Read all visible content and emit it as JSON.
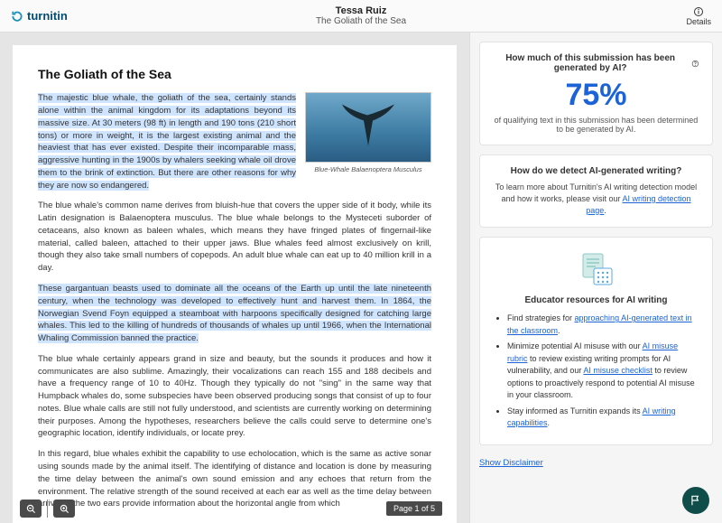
{
  "header": {
    "brand": "turnitin",
    "student_name": "Tessa Ruiz",
    "doc_title": "The Goliath of the Sea",
    "details_label": "Details"
  },
  "document": {
    "title": "The Goliath of the Sea",
    "image_caption": "Blue-Whale Balaenoptera Musculus",
    "p1a": "The majestic blue whale, the goliath of the sea, certainly stands alone within the animal kingdom for its adaptations beyond its massive size. At 30 meters (98 ft) in length and 190 tons (210 short tons) or more in weight, it is the largest existing animal and the heaviest that has ever existed. Despite their incomparable mass, aggressive hunting in the 1900s by whalers seeking whale oil drove them to the brink of extinction. But there are other reasons for why they are now so endangered.",
    "p2": "The blue whale's common name derives from bluish-hue that covers the upper side of it body, while its Latin designation is Balaenoptera musculus. The blue whale belongs to the Mysteceti suborder of cetaceans, also known as baleen whales, which means they have fringed plates of fingernail-like material, called baleen, attached to their upper jaws. Blue whales feed almost exclusively on krill, though they also take small numbers of copepods. An adult blue whale can eat up to 40 million krill in a day.",
    "p3": "These gargantuan beasts used to dominate all the oceans of the Earth up until the late nineteenth century, when the technology was developed to effectively hunt and harvest them. In 1864, the Norwegian Svend Foyn equipped a steamboat with harpoons specifically designed for catching large whales. This led to the killing of hundreds of thousands of whales up until 1966, when the International Whaling Commission banned the practice.",
    "p4": "The blue whale certainly appears grand in size and beauty, but the sounds it produces and how it communicates are also sublime. Amazingly, their vocalizations can reach 155 and 188 decibels and have a frequency range of 10 to 40Hz. Though they typically do not \"sing\" in the same way that Humpback whales do, some subspecies have been observed producing songs that consist of up to four notes. Blue whale calls are still not fully understood, and scientists are currently working on determining their purposes. Among the hypotheses, researchers believe the calls could serve to determine one's geographic location, identify individuals, or locate prey.",
    "p5": "In this regard, blue whales exhibit the capability to use echolocation, which is the same as active sonar using sounds made by the animal itself. The identifying of distance and location is done by measuring the time delay between the animal's own sound emission and any echoes that return from the environment. The relative strength of the sound received at each ear as well as the time delay between arrival at the two ears provide information about the horizontal angle from which"
  },
  "toolbar": {
    "page_indicator": "Page 1 of 5"
  },
  "ai_panel": {
    "heading": "How much of this submission has been generated by AI?",
    "percentage": "75%",
    "subtext": "of qualifying text in this submission has been determined to be generated by AI."
  },
  "detect_panel": {
    "heading": "How do we detect AI-generated writing?",
    "text_before": "To learn more about Turnitin's AI writing detection model and how it works, please visit our ",
    "link": "AI writing detection page",
    "text_after": "."
  },
  "resources": {
    "heading": "Educator resources for AI writing",
    "b1_before": "Find strategies for ",
    "b1_link": "approaching AI-generated text in the classroom",
    "b1_after": ".",
    "b2_before": "Minimize potential AI misuse with our ",
    "b2_link1": "AI misuse rubric",
    "b2_mid": " to review existing writing prompts for AI vulnerability, and our ",
    "b2_link2": "AI misuse checklist",
    "b2_after": " to review options to proactively respond to potential AI misuse in your classroom.",
    "b3_before": "Stay informed as Turnitin expands its ",
    "b3_link": "AI writing capabilities",
    "b3_after": "."
  },
  "disclaimer_label": "Show Disclaimer"
}
